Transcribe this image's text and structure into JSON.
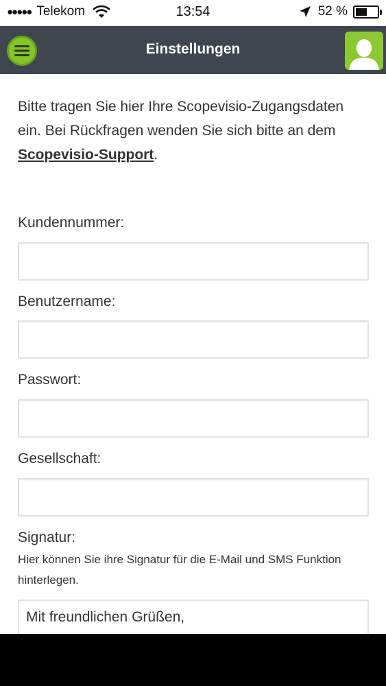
{
  "status_bar": {
    "carrier": "Telekom",
    "signal_dots": "●●●●●",
    "time": "13:54",
    "battery_percent": "52 %",
    "battery_level": 0.52
  },
  "header": {
    "title": "Einstellungen",
    "menu_icon": "hamburger-icon",
    "user_icon": "user-icon",
    "accent_color": "#86c529",
    "bar_color": "#3f4650"
  },
  "intro": {
    "text": "Bitte tragen Sie hier Ihre Scopevisio-Zugangsdaten ein. Bei Rückfragen wenden Sie sich bitte an dem ",
    "link_label": "Scopevisio-Support",
    "suffix": "."
  },
  "form": {
    "customer_number_label": "Kundennummer:",
    "customer_number_value": "",
    "username_label": "Benutzername:",
    "username_value": "",
    "password_label": "Passwort:",
    "password_value": "",
    "company_label": "Gesellschaft:",
    "company_value": "",
    "signature_label": "Signatur:",
    "signature_hint": "Hier können Sie ihre Signatur für die E-Mail und SMS Funktion hinterlegen.",
    "signature_value": "Mit freundlichen Grüßen,"
  }
}
